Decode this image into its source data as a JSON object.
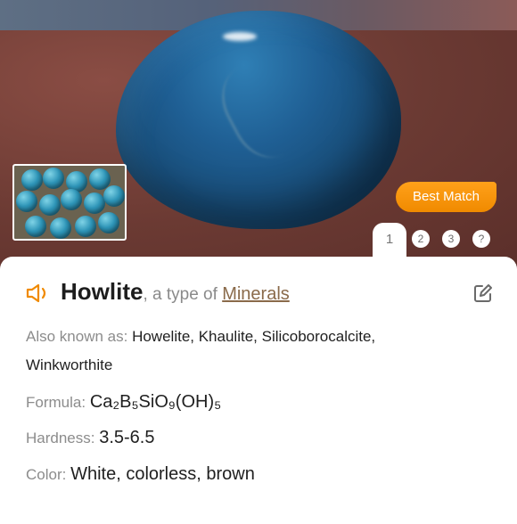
{
  "header": {
    "best_match": "Best Match",
    "tabs": [
      "1",
      "2",
      "3",
      "?"
    ]
  },
  "result": {
    "name": "Howlite",
    "type_prefix": ", a type of ",
    "type_link": "Minerals",
    "aliases_label": "Also known as:",
    "aliases_line1": "Howelite, Khaulite, Silicoborocalcite,",
    "aliases_line2": "Winkworthite",
    "formula_label": "Formula:",
    "formula_value": "Ca₂B₅SiO₉(OH)₅",
    "hardness_label": "Hardness:",
    "hardness_value": "3.5-6.5",
    "color_label": "Color:",
    "color_value": "White, colorless, brown"
  },
  "colors": {
    "accent": "#f08a00",
    "link": "#8a6a4a"
  },
  "icons": {
    "speaker": "speaker-icon",
    "edit": "edit-icon"
  }
}
